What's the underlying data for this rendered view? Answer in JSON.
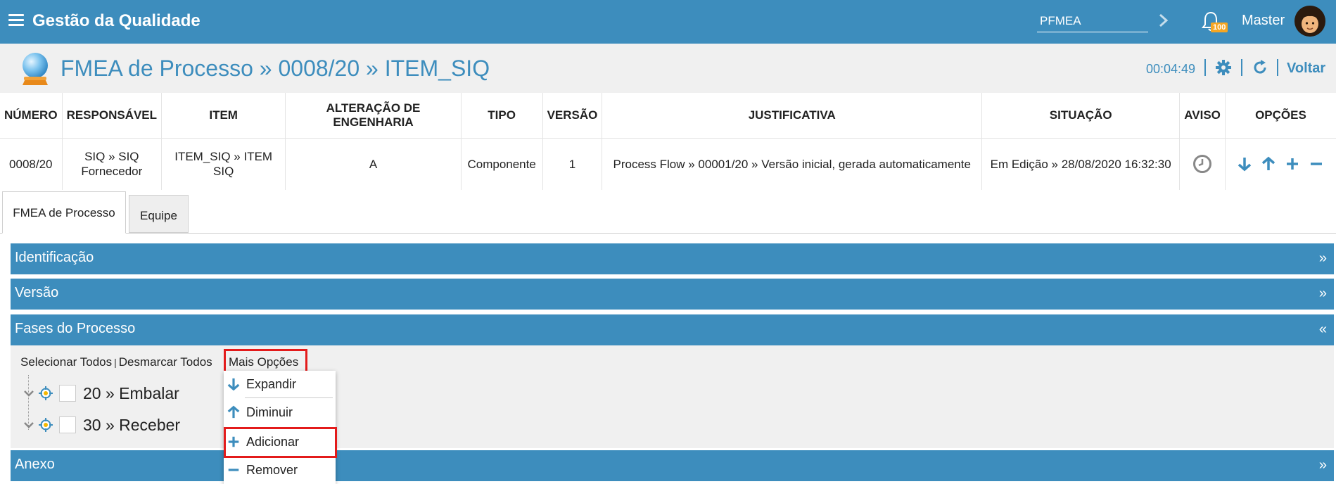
{
  "topbar": {
    "app_title": "Gestão da Qualidade",
    "module_value": "PFMEA",
    "notification_count": "100",
    "username": "Master"
  },
  "header": {
    "title": "FMEA de Processo » 0008/20 » ITEM_SIQ",
    "timer": "00:04:49",
    "back_label": "Voltar"
  },
  "info_table": {
    "headers": [
      "NÚMERO",
      "RESPONSÁVEL",
      "ITEM",
      "ALTERAÇÃO DE ENGENHARIA",
      "TIPO",
      "VERSÃO",
      "JUSTIFICATIVA",
      "SITUAÇÃO",
      "AVISO",
      "OPÇÕES"
    ],
    "row": {
      "numero": "0008/20",
      "responsavel_1": "SIQ » SIQ",
      "responsavel_2": "Fornecedor",
      "item": "ITEM_SIQ » ITEM SIQ",
      "alteracao": "A",
      "tipo": "Componente",
      "versao": "1",
      "justificativa": "Process Flow » 00001/20 » Versão inicial, gerada automaticamente",
      "situacao": "Em Edição » 28/08/2020 16:32:30"
    }
  },
  "tabs": [
    {
      "label": "FMEA de Processo"
    },
    {
      "label": "Equipe"
    }
  ],
  "panels": [
    {
      "label": "Identificação",
      "toggle": "»"
    },
    {
      "label": "Versão",
      "toggle": "»"
    },
    {
      "label": "Fases do Processo",
      "toggle": "«"
    },
    {
      "label": "Anexo",
      "toggle": "»"
    }
  ],
  "toolbar": {
    "select_all": "Selecionar Todos",
    "separator": "|",
    "deselect_all": "Desmarcar Todos",
    "more_options": "Mais Opções"
  },
  "tree": [
    {
      "label": "20 » Embalar"
    },
    {
      "label": "30 » Receber"
    }
  ],
  "dropdown": [
    {
      "label": "Expandir",
      "icon": "arrow-down-icon"
    },
    {
      "label": "Diminuir",
      "icon": "arrow-up-icon"
    },
    {
      "label": "Adicionar",
      "icon": "plus-icon"
    },
    {
      "label": "Remover",
      "icon": "minus-icon"
    }
  ],
  "colors": {
    "primary": "#3d8dbd",
    "highlight": "#e31b1b",
    "badge": "#f5a623"
  }
}
